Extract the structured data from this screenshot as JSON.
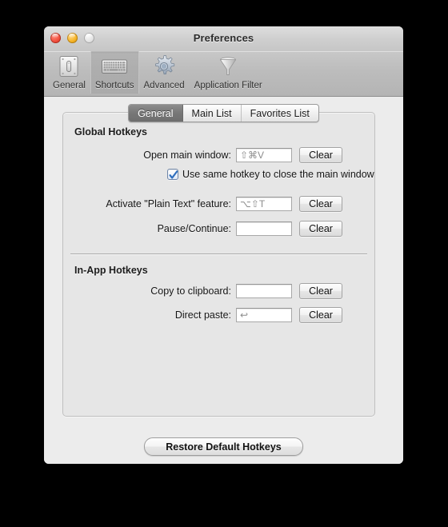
{
  "window": {
    "title": "Preferences",
    "traffic_lights": [
      {
        "name": "close",
        "color": "#f2503f"
      },
      {
        "name": "minimize",
        "color": "#f6b427"
      },
      {
        "name": "zoom",
        "color": "#e2e2e2"
      }
    ]
  },
  "toolbar": {
    "items": [
      {
        "label": "General",
        "icon": "light-switch-icon",
        "selected": false
      },
      {
        "label": "Shortcuts",
        "icon": "keyboard-icon",
        "selected": true
      },
      {
        "label": "Advanced",
        "icon": "gear-icon",
        "selected": false
      },
      {
        "label": "Application Filter",
        "icon": "funnel-icon",
        "selected": false
      }
    ]
  },
  "tabs": [
    {
      "label": "General",
      "active": true
    },
    {
      "label": "Main List",
      "active": false
    },
    {
      "label": "Favorites List",
      "active": false
    }
  ],
  "sections": {
    "global": {
      "title": "Global Hotkeys",
      "rows": [
        {
          "label": "Open main window:",
          "value": "⇧⌘V",
          "clear_label": "Clear"
        },
        {
          "label": "Activate \"Plain Text\" feature:",
          "value": "⌥⇧T",
          "clear_label": "Clear"
        },
        {
          "label": "Pause/Continue:",
          "value": "",
          "clear_label": "Clear"
        }
      ],
      "checkbox": {
        "label": "Use same hotkey to close the main window",
        "checked": true
      }
    },
    "inapp": {
      "title": "In-App Hotkeys",
      "rows": [
        {
          "label": "Copy to clipboard:",
          "value": "",
          "clear_label": "Clear"
        },
        {
          "label": "Direct paste:",
          "value": "↩",
          "clear_label": "Clear"
        }
      ]
    }
  },
  "footer": {
    "restore_label": "Restore Default Hotkeys"
  },
  "colors": {
    "window_bg": "#ececec",
    "tabbox_bg": "#e6e6e6",
    "toolbar_bg": "#bcbcbc",
    "active_tab_bg": "#777777",
    "checkbox_accent": "#3a78c8",
    "hotkey_text": "#8d8d8d"
  }
}
